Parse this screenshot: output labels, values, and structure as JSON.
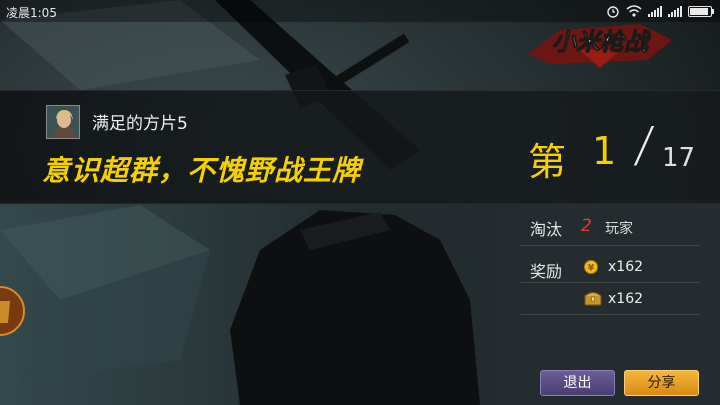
{
  "status_bar": {
    "time": "凌晨1:05"
  },
  "game": {
    "logo_text": "小米枪战"
  },
  "result": {
    "player_name": "满足的方片5",
    "slogan": "意识超群，不愧野战王牌",
    "rank_prefix": "第",
    "rank_value": "1",
    "rank_separator": "/",
    "rank_total": "17"
  },
  "stats": {
    "kills_label": "淘汰",
    "kills_value": "2",
    "kills_unit": "玩家",
    "reward_label": "奖励",
    "reward_coin": "x162",
    "reward_chest": "x162"
  },
  "buttons": {
    "exit": "退出",
    "share": "分享"
  },
  "colors": {
    "highlight": "#f4d000",
    "kill_number": "#e83a2a",
    "exit_bg": "#5a4d84",
    "share_bg": "#e89a20"
  }
}
